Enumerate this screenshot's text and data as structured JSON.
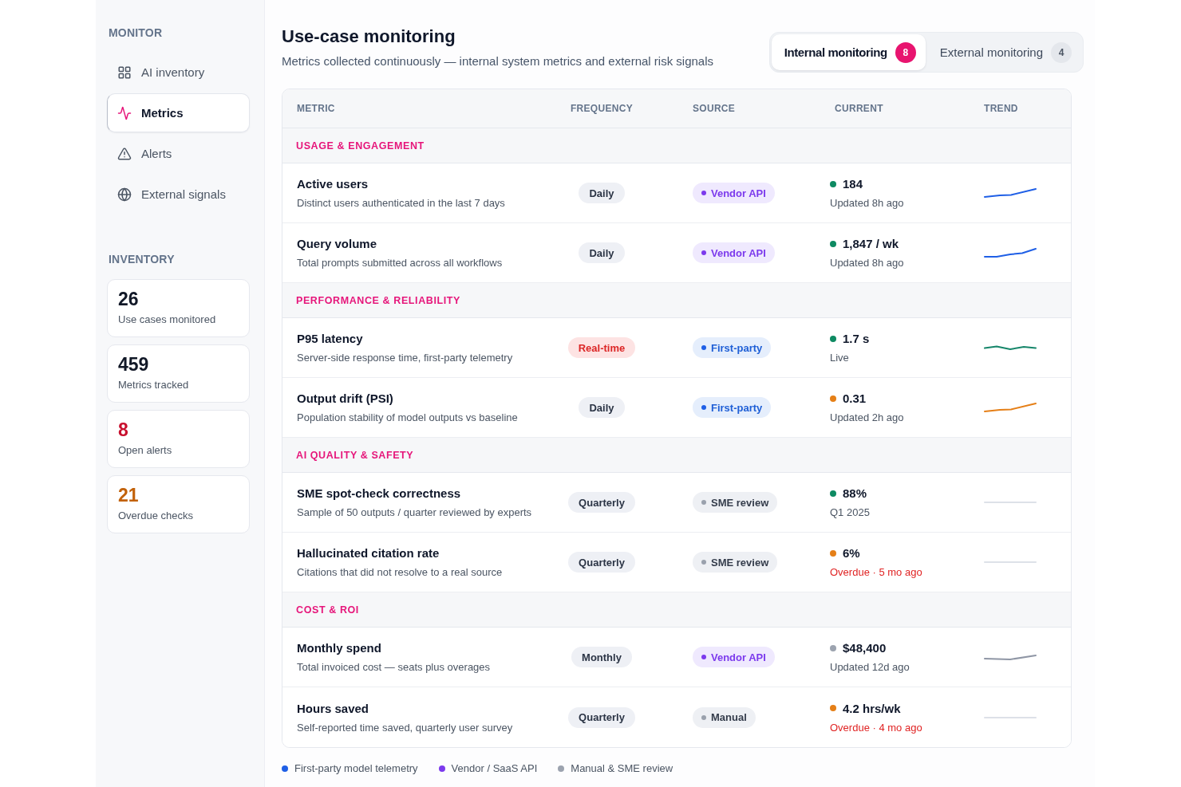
{
  "sidebar": {
    "monitor_heading": "MONITOR",
    "items": [
      {
        "label": "AI inventory",
        "selected": false
      },
      {
        "label": "Metrics",
        "selected": true
      },
      {
        "label": "Alerts",
        "selected": false
      },
      {
        "label": "External signals",
        "selected": false
      }
    ],
    "inventory_heading": "INVENTORY",
    "stats": [
      {
        "value": "26",
        "label": "Use cases monitored",
        "color": "#111827"
      },
      {
        "value": "459",
        "label": "Metrics tracked",
        "color": "#111827"
      },
      {
        "value": "8",
        "label": "Open alerts",
        "color": "#c8102e"
      },
      {
        "value": "21",
        "label": "Overdue checks",
        "color": "#c2620a"
      }
    ]
  },
  "header": {
    "title": "Use-case monitoring",
    "subtitle": "Metrics collected continuously — internal system metrics and external risk signals"
  },
  "tabs": [
    {
      "label": "Internal monitoring",
      "count": "8",
      "selected": true
    },
    {
      "label": "External monitoring",
      "count": "4",
      "selected": false
    }
  ],
  "table": {
    "columns": [
      "METRIC",
      "FREQUENCY",
      "SOURCE",
      "CURRENT",
      "TREND"
    ],
    "groups": [
      {
        "title": "USAGE & ENGAGEMENT",
        "rows": [
          {
            "name": "Active users",
            "description": "Distinct users authenticated in the last 7 days",
            "frequency": {
              "label": "Daily",
              "kind": "periodic"
            },
            "source": {
              "label": "Vendor API",
              "kind": "vendor"
            },
            "current": {
              "value": "184",
              "note": "Updated 8h ago",
              "color": "#0e8a62",
              "overdue": false
            },
            "trend": {
              "kind": "rise",
              "color": "#1f5fe6"
            }
          },
          {
            "name": "Query volume",
            "description": "Total prompts submitted across all workflows",
            "frequency": {
              "label": "Daily",
              "kind": "periodic"
            },
            "source": {
              "label": "Vendor API",
              "kind": "vendor"
            },
            "current": {
              "value": "1,847 / wk",
              "note": "Updated 8h ago",
              "color": "#0e8a62",
              "overdue": false
            },
            "trend": {
              "kind": "step",
              "color": "#1f5fe6"
            }
          }
        ]
      },
      {
        "title": "PERFORMANCE & RELIABILITY",
        "rows": [
          {
            "name": "P95 latency",
            "description": "Server-side response time, first-party telemetry",
            "frequency": {
              "label": "Real-time",
              "kind": "live"
            },
            "source": {
              "label": "First-party",
              "kind": "first_party"
            },
            "current": {
              "value": "1.7 s",
              "note": "Live",
              "color": "#0e8a62",
              "overdue": false
            },
            "trend": {
              "kind": "wave",
              "color": "#16866a"
            }
          },
          {
            "name": "Output drift (PSI)",
            "description": "Population stability of model outputs vs baseline",
            "frequency": {
              "label": "Daily",
              "kind": "periodic"
            },
            "source": {
              "label": "First-party",
              "kind": "first_party"
            },
            "current": {
              "value": "0.31",
              "note": "Updated 2h ago",
              "color": "#e57f17",
              "overdue": false
            },
            "trend": {
              "kind": "rise",
              "color": "#e57f17"
            }
          }
        ]
      },
      {
        "title": "AI QUALITY & SAFETY",
        "rows": [
          {
            "name": "SME spot-check correctness",
            "description": "Sample of 50 outputs / quarter reviewed by experts",
            "frequency": {
              "label": "Quarterly",
              "kind": "periodic"
            },
            "source": {
              "label": "SME review",
              "kind": "manual"
            },
            "current": {
              "value": "88%",
              "note": "Q1 2025",
              "color": "#0e8a62",
              "overdue": false
            },
            "trend": {
              "kind": "flat",
              "color": "#dde1e8"
            }
          },
          {
            "name": "Hallucinated citation rate",
            "description": "Citations that did not resolve to a real source",
            "frequency": {
              "label": "Quarterly",
              "kind": "periodic"
            },
            "source": {
              "label": "SME review",
              "kind": "manual"
            },
            "current": {
              "value": "6%",
              "note": "Overdue · 5 mo ago",
              "color": "#e57f17",
              "overdue": true
            },
            "trend": {
              "kind": "flat",
              "color": "#dde1e8"
            }
          }
        ]
      },
      {
        "title": "COST & ROI",
        "rows": [
          {
            "name": "Monthly spend",
            "description": "Total invoiced cost — seats plus overages",
            "frequency": {
              "label": "Monthly",
              "kind": "periodic"
            },
            "source": {
              "label": "Vendor API",
              "kind": "vendor"
            },
            "current": {
              "value": "$48,400",
              "note": "Updated 12d ago",
              "color": "#9ca3af",
              "overdue": false
            },
            "trend": {
              "kind": "drift",
              "color": "#8f96a5"
            }
          },
          {
            "name": "Hours saved",
            "description": "Self-reported time saved, quarterly user survey",
            "frequency": {
              "label": "Quarterly",
              "kind": "periodic"
            },
            "source": {
              "label": "Manual",
              "kind": "manual"
            },
            "current": {
              "value": "4.2 hrs/wk",
              "note": "Overdue · 4 mo ago",
              "color": "#e57f17",
              "overdue": true
            },
            "trend": {
              "kind": "flat",
              "color": "#dde1e8"
            }
          }
        ]
      }
    ]
  },
  "legend": [
    {
      "label": "First-party model telemetry",
      "color": "#1f5fe6"
    },
    {
      "label": "Vendor / SaaS API",
      "color": "#7c3aed"
    },
    {
      "label": "Manual & SME review",
      "color": "#9ca3af"
    }
  ]
}
